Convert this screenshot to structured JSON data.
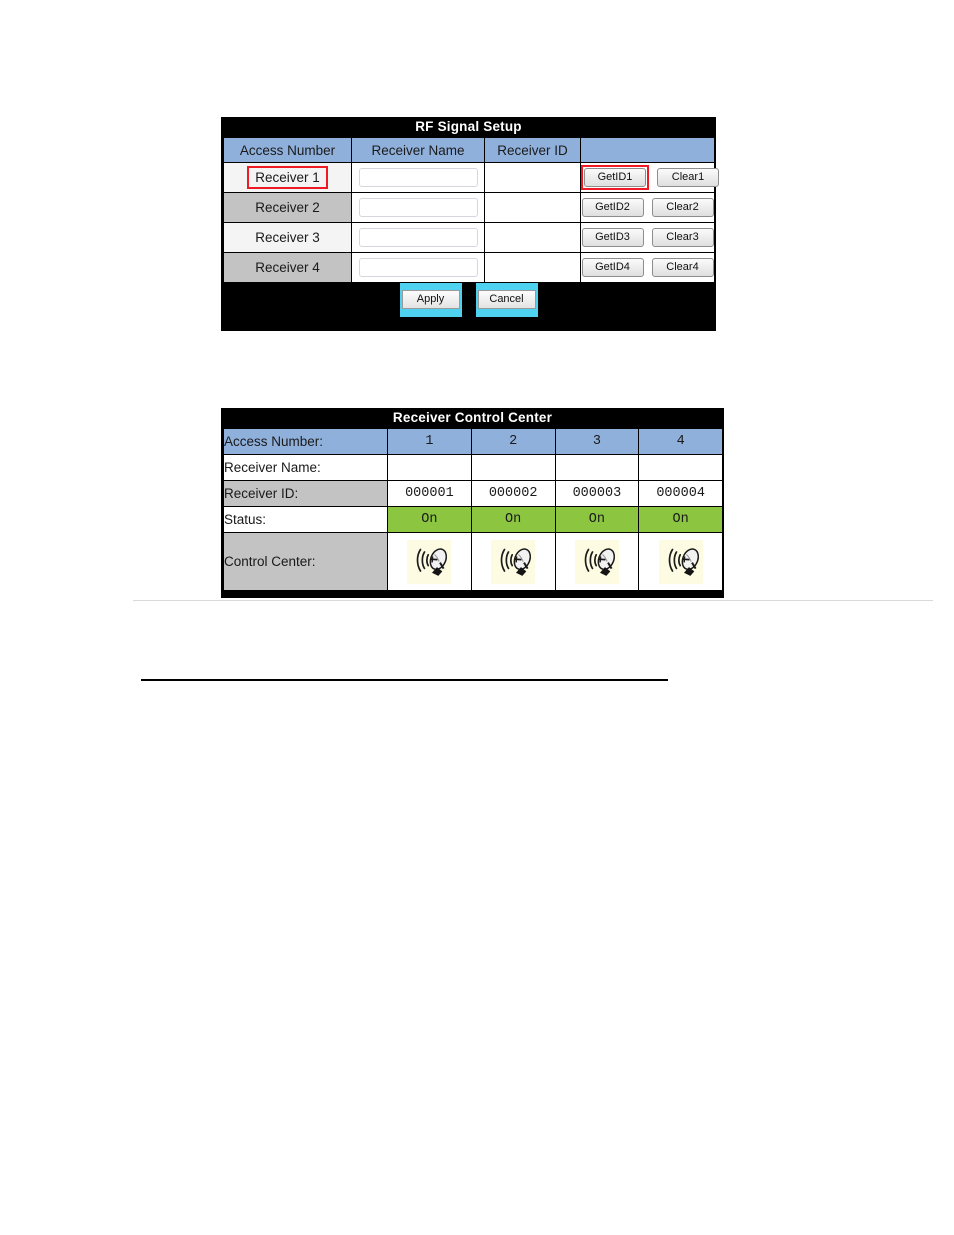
{
  "rf_signal_setup": {
    "title": "RF Signal Setup",
    "columns": [
      "Access Number",
      "Receiver Name",
      "Receiver ID",
      ""
    ],
    "rows": [
      {
        "access_number": "Receiver 1",
        "receiver_name": "",
        "receiver_name_placeholder": "",
        "receiver_id": "",
        "get_id_label": "GetID1",
        "clear_label": "Clear1",
        "access_highlighted": true,
        "get_id_highlighted": true,
        "shade": "light"
      },
      {
        "access_number": "Receiver 2",
        "receiver_name": "",
        "receiver_name_placeholder": "",
        "receiver_id": "",
        "get_id_label": "GetID2",
        "clear_label": "Clear2",
        "access_highlighted": false,
        "get_id_highlighted": false,
        "shade": "dark"
      },
      {
        "access_number": "Receiver 3",
        "receiver_name": "",
        "receiver_name_placeholder": "",
        "receiver_id": "",
        "get_id_label": "GetID3",
        "clear_label": "Clear3",
        "access_highlighted": false,
        "get_id_highlighted": false,
        "shade": "light"
      },
      {
        "access_number": "Receiver 4",
        "receiver_name": "",
        "receiver_name_placeholder": "",
        "receiver_id": "",
        "get_id_label": "GetID4",
        "clear_label": "Clear4",
        "access_highlighted": false,
        "get_id_highlighted": false,
        "shade": "dark"
      }
    ],
    "apply_label": "Apply",
    "cancel_label": "Cancel"
  },
  "receiver_control_center": {
    "title": "Receiver Control Center",
    "row_labels": {
      "access_number": "Access Number:",
      "receiver_name": "Receiver Name:",
      "receiver_id": "Receiver ID:",
      "status": "Status:",
      "control_center": "Control Center:"
    },
    "access_numbers": [
      "1",
      "2",
      "3",
      "4"
    ],
    "receiver_names": [
      "",
      "",
      "",
      ""
    ],
    "receiver_ids": [
      "000001",
      "000002",
      "000003",
      "000004"
    ],
    "statuses": [
      "On",
      "On",
      "On",
      "On"
    ],
    "control_center_icons": [
      "satellite-dish-icon",
      "satellite-dish-icon",
      "satellite-dish-icon",
      "satellite-dish-icon"
    ]
  },
  "colors": {
    "header_blue": "#90b0dc",
    "panel_black": "#000000",
    "row_gray": "#c3c3c3",
    "row_light": "#f4f4f4",
    "status_green": "#8cc540",
    "highlight_red": "#ee1b24",
    "focus_cyan": "#4fd2f0",
    "icon_background": "#fdfbe2"
  }
}
